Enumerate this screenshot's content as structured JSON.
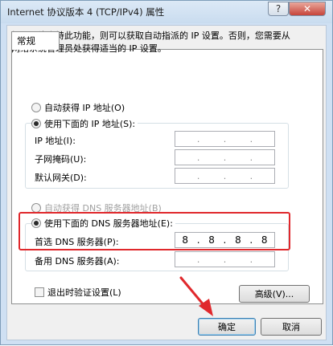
{
  "window": {
    "title": "Internet 协议版本 4 (TCP/IPv4) 属性",
    "help_glyph": "?",
    "close_glyph": "✕"
  },
  "tab": {
    "label": "常规"
  },
  "description": "如果网络支持此功能，则可以获取自动指派的 IP 设置。否则，您需要从网络系统管理员处获得适当的 IP 设置。",
  "ip_section": {
    "auto_label": "自动获得 IP 地址(O)",
    "manual_label": "使用下面的 IP 地址(S):",
    "fields": [
      {
        "label": "IP 地址(I):",
        "value": ". . ."
      },
      {
        "label": "子网掩码(U):",
        "value": ". . ."
      },
      {
        "label": "默认网关(D):",
        "value": ". . ."
      }
    ],
    "selected": "manual"
  },
  "dns_section": {
    "auto_label": "自动获得 DNS 服务器地址(B)",
    "manual_label": "使用下面的 DNS 服务器地址(E):",
    "preferred_label": "首选 DNS 服务器(P):",
    "preferred_octets": [
      "8",
      "8",
      "8",
      "8"
    ],
    "alternate_label": "备用 DNS 服务器(A):",
    "selected": "manual"
  },
  "validate_on_exit_label": "退出时验证设置(L)",
  "advanced_button": "高级(V)...",
  "ok_button": "确定",
  "cancel_button": "取消",
  "colors": {
    "highlight": "#e0282c",
    "arrow": "#e0282c"
  }
}
